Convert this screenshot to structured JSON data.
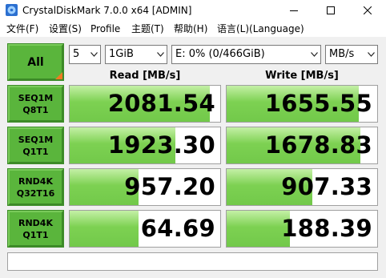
{
  "window": {
    "title": "CrystalDiskMark 7.0.0 x64 [ADMIN]",
    "icon": "crystaldiskmark-app-icon",
    "controls": [
      "minimize-icon",
      "maximize-icon",
      "close-icon"
    ]
  },
  "menu": {
    "items": [
      {
        "label": "文件(F)"
      },
      {
        "label": "设置(S)"
      },
      {
        "label": "Profile"
      },
      {
        "label": "主题(T)"
      },
      {
        "label": "帮助(H)"
      },
      {
        "label": "语言(L)(Language)"
      }
    ]
  },
  "toolbar": {
    "all_label": "All",
    "count": "5",
    "size": "1GiB",
    "drive": "E: 0% (0/466GiB)",
    "unit": "MB/s"
  },
  "headers": {
    "read": "Read [MB/s]",
    "write": "Write [MB/s]"
  },
  "results": [
    {
      "line1": "SEQ1M",
      "line2": "Q8T1",
      "read": "2081.54",
      "write": "1655.55",
      "read_fill": 0.93,
      "write_fill": 0.88
    },
    {
      "line1": "SEQ1M",
      "line2": "Q1T1",
      "read": "1923.30",
      "write": "1678.83",
      "read_fill": 0.7,
      "write_fill": 0.89
    },
    {
      "line1": "RND4K",
      "line2": "Q32T16",
      "read": "957.20",
      "write": "907.33",
      "read_fill": 0.46,
      "write_fill": 0.57
    },
    {
      "line1": "RND4K",
      "line2": "Q1T1",
      "read": "64.69",
      "write": "188.39",
      "read_fill": 0.46,
      "write_fill": 0.42
    }
  ],
  "comment": "",
  "colors": {
    "button_green": "#5ab53c",
    "bar_green": "#72c94a",
    "accent_orange": "#f07a22"
  }
}
